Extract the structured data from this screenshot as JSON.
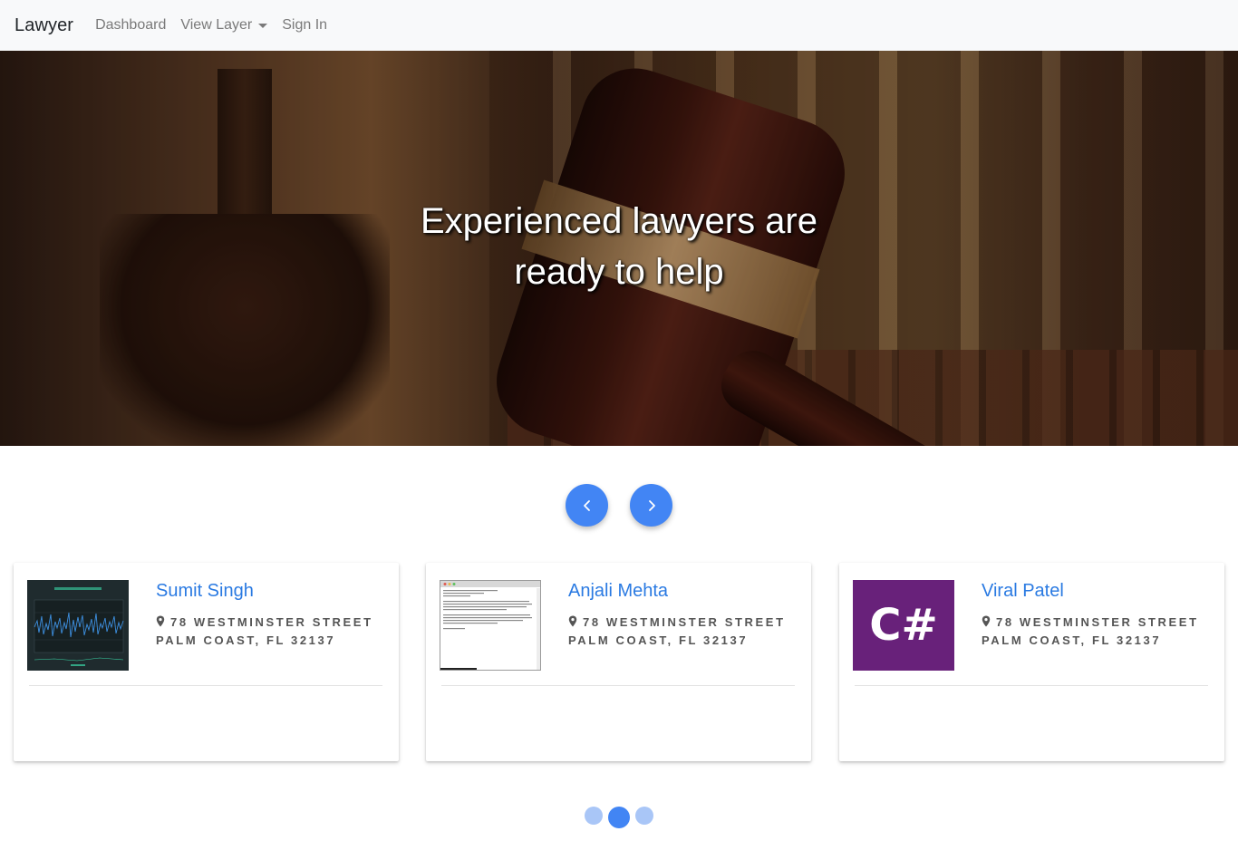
{
  "navbar": {
    "brand": "Lawyer",
    "links": [
      {
        "label": "Dashboard"
      },
      {
        "label": "View Layer",
        "dropdown": true
      },
      {
        "label": "Sign In"
      }
    ]
  },
  "hero": {
    "title_line1": "Experienced lawyers are",
    "title_line2": "ready to help"
  },
  "carousel": {
    "prev_icon": "chevron-left-icon",
    "next_icon": "chevron-right-icon",
    "accent_color": "#4285f4",
    "active_dot_index": 1,
    "dot_count": 3
  },
  "cards": [
    {
      "name": "Sumit Singh",
      "address_line1": "78 Westminster Street",
      "address_line2": "Palm Coast, FL 32137",
      "thumb": "chart-thumbnail"
    },
    {
      "name": "Anjali Mehta",
      "address_line1": "78 Westminster Street",
      "address_line2": "Palm Coast, FL 32137",
      "thumb": "terminal-thumbnail"
    },
    {
      "name": "Viral Patel",
      "address_line1": "78 Westminster Street",
      "address_line2": "Palm Coast, FL 32137",
      "thumb": "csharp-logo",
      "thumb_text": "C#"
    }
  ]
}
